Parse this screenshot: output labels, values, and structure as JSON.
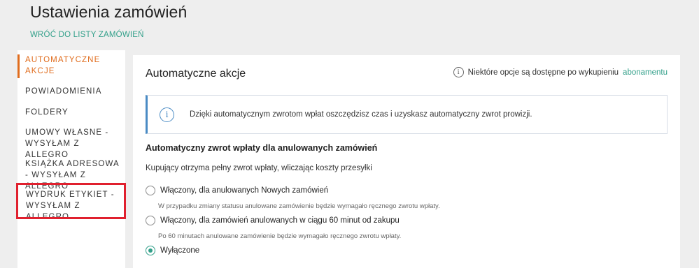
{
  "header": {
    "title": "Ustawienia zamówień",
    "back_link": "WRÓĆ DO LISTY ZAMÓWIEŃ"
  },
  "sidebar": {
    "items": [
      {
        "label": "AUTOMATYCZNE AKCJE"
      },
      {
        "label": "POWIADOMIENIA"
      },
      {
        "label": "FOLDERY"
      },
      {
        "label": "UMOWY WŁASNE - WYSYŁAM Z ALLEGRO"
      },
      {
        "label": "KSIĄŻKA ADRESOWA - WYSYŁAM Z ALLEGRO"
      },
      {
        "label": "WYDRUK ETYKIET - WYSYŁAM Z ALLEGRO"
      }
    ]
  },
  "main": {
    "title": "Automatyczne akcje",
    "note_text": "Niektóre opcje są dostępne po wykupieniu",
    "note_link": "abonamentu",
    "alert_text": "Dzięki automatycznym zwrotom wpłat oszczędzisz czas i uzyskasz automatyczny zwrot prowizji.",
    "section_title": "Automatyczny zwrot wpłaty dla anulowanych zamówień",
    "section_desc": "Kupujący otrzyma pełny zwrot wpłaty, wliczając koszty przesyłki",
    "options": [
      {
        "label": "Włączony, dla anulowanych Nowych zamówień",
        "hint": "W przypadku zmiany statusu anulowane zamówienie będzie wymagało ręcznego zwrotu wpłaty."
      },
      {
        "label": "Włączony, dla zamówień anulowanych w ciągu 60 minut od zakupu",
        "hint": "Po 60 minutach anulowane zamówienie będzie wymagało ręcznego zwrotu wpłaty."
      },
      {
        "label": "Wyłączone",
        "hint": ""
      }
    ],
    "selected_option": "Wyłączone"
  },
  "colors": {
    "accent": "#33a08a",
    "active": "#e06c1d",
    "highlight": "#e0202e",
    "info": "#4a8bc4"
  }
}
